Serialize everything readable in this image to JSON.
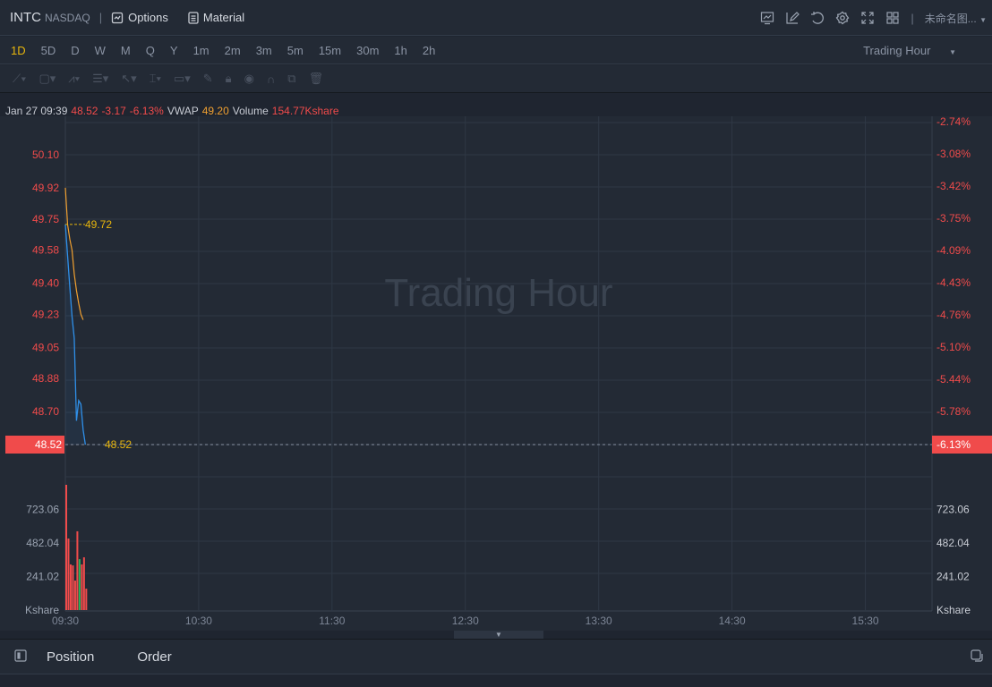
{
  "header": {
    "symbol": "INTC",
    "exchange": "NASDAQ",
    "options_label": "Options",
    "material_label": "Material",
    "layout_name": "未命名图..."
  },
  "periods": [
    "1D",
    "5D",
    "D",
    "W",
    "M",
    "Q",
    "Y",
    "1m",
    "2m",
    "3m",
    "5m",
    "15m",
    "30m",
    "1h",
    "2h"
  ],
  "active_period": "1D",
  "session_select": "Trading Hour",
  "watermark": "Trading Hour",
  "info": {
    "datetime": "Jan 27 09:39",
    "price": "48.52",
    "change": "-3.17",
    "change_pct": "-6.13%",
    "vwap_label": "VWAP",
    "vwap": "49.20",
    "volume_label": "Volume",
    "volume": "154.77Kshare"
  },
  "bottom": {
    "tabs": [
      "Position",
      "Order"
    ]
  },
  "colors": {
    "up": "#f04b4b",
    "down": "#26b35a",
    "price_line": "#2f8fe8",
    "vwap_line": "#f0a030",
    "accent": "#e8b60c"
  },
  "chart_data": {
    "type": "line",
    "price_axis": {
      "labels": [
        "50.10",
        "49.92",
        "49.75",
        "49.58",
        "49.40",
        "49.23",
        "49.05",
        "48.88",
        "48.70",
        "48.52"
      ],
      "range": [
        48.52,
        50.1
      ]
    },
    "pct_axis": {
      "labels": [
        "-2.74%",
        "-3.08%",
        "-3.42%",
        "-3.75%",
        "-4.09%",
        "-4.43%",
        "-4.76%",
        "-5.10%",
        "-5.44%",
        "-5.78%",
        "-6.13%"
      ]
    },
    "last_price_label": "48.52",
    "last_pct_label": "-6.13%",
    "open_marker": "49.72",
    "last_marker": "48.52",
    "x_ticks": [
      "09:30",
      "10:30",
      "11:30",
      "12:30",
      "13:30",
      "14:30",
      "15:30"
    ],
    "minutes_total": 390,
    "price_series": [
      [
        0,
        49.72
      ],
      [
        1,
        49.55
      ],
      [
        2,
        49.38
      ],
      [
        3,
        49.22
      ],
      [
        4,
        49.1
      ],
      [
        5,
        48.65
      ],
      [
        6,
        48.76
      ],
      [
        7,
        48.74
      ],
      [
        8,
        48.6
      ],
      [
        9,
        48.52
      ]
    ],
    "vwap_series": [
      [
        0,
        49.92
      ],
      [
        1,
        49.72
      ],
      [
        2,
        49.64
      ],
      [
        3,
        49.58
      ],
      [
        4,
        49.45
      ],
      [
        5,
        49.36
      ],
      [
        6,
        49.29
      ],
      [
        7,
        49.23
      ],
      [
        8,
        49.2
      ]
    ],
    "volume_axis": {
      "labels": [
        "723.06",
        "482.04",
        "241.02"
      ],
      "values": [
        723.06,
        482.04,
        241.02
      ],
      "unit": "Kshare"
    },
    "volume": [
      {
        "m": 0,
        "v": 900,
        "up": true
      },
      {
        "m": 1,
        "v": 514,
        "up": true
      },
      {
        "m": 2,
        "v": 328,
        "up": true
      },
      {
        "m": 3,
        "v": 321,
        "up": true
      },
      {
        "m": 4,
        "v": 212,
        "up": true
      },
      {
        "m": 5,
        "v": 566,
        "up": true
      },
      {
        "m": 6,
        "v": 366,
        "up": false
      },
      {
        "m": 7,
        "v": 328,
        "up": true
      },
      {
        "m": 8,
        "v": 379,
        "up": true
      },
      {
        "m": 9,
        "v": 154,
        "up": true
      }
    ]
  }
}
